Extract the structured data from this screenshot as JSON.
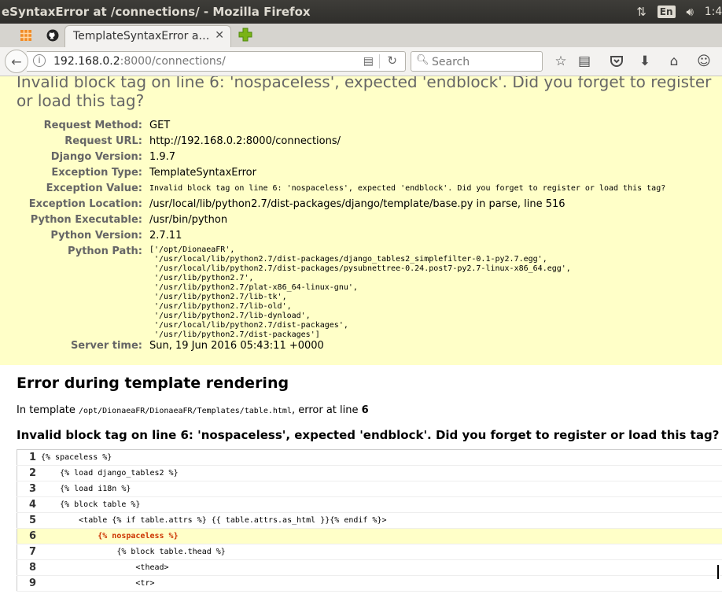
{
  "window": {
    "title": "eSyntaxError at /connections/ - Mozilla Firefox"
  },
  "tray": {
    "keyboard_layout": "En",
    "clock": "1:4"
  },
  "tabs": {
    "active_label": "TemplateSyntaxError a…"
  },
  "navbar": {
    "url_host": "192.168.0.2",
    "url_rest": ":8000/connections/",
    "search_placeholder": "Search"
  },
  "page": {
    "error_heading": "Invalid block tag on line 6: 'nospaceless', expected 'endblock'. Did you forget to register or load this tag?",
    "meta": [
      {
        "label": "Request Method:",
        "value": "GET"
      },
      {
        "label": "Request URL:",
        "value": "http://192.168.0.2:8000/connections/"
      },
      {
        "label": "Django Version:",
        "value": "1.9.7"
      },
      {
        "label": "Exception Type:",
        "value": "TemplateSyntaxError"
      },
      {
        "label": "Exception Value:",
        "value": "Invalid block tag on line 6: 'nospaceless', expected 'endblock'. Did you forget to register or load this tag?"
      },
      {
        "label": "Exception Location:",
        "value": "/usr/local/lib/python2.7/dist-packages/django/template/base.py in parse, line 516"
      },
      {
        "label": "Python Executable:",
        "value": "/usr/bin/python"
      },
      {
        "label": "Python Version:",
        "value": "2.7.11"
      },
      {
        "label": "Python Path:",
        "value": "['/opt/DionaeaFR',\n '/usr/local/lib/python2.7/dist-packages/django_tables2_simplefilter-0.1-py2.7.egg',\n '/usr/local/lib/python2.7/dist-packages/pysubnettree-0.24.post7-py2.7-linux-x86_64.egg',\n '/usr/lib/python2.7',\n '/usr/lib/python2.7/plat-x86_64-linux-gnu',\n '/usr/lib/python2.7/lib-tk',\n '/usr/lib/python2.7/lib-old',\n '/usr/lib/python2.7/lib-dynload',\n '/usr/local/lib/python2.7/dist-packages',\n '/usr/lib/python2.7/dist-packages']"
      },
      {
        "label": "Server time:",
        "value": "Sun, 19 Jun 2016 05:43:11 +0000"
      }
    ],
    "template": {
      "heading": "Error during template rendering",
      "info_prefix": "In template ",
      "path": "/opt/DionaeaFR/DionaeaFR/Templates/table.html",
      "info_mid": ", error at line ",
      "line": "6",
      "error": "Invalid block tag on line 6: 'nospaceless', expected 'endblock'. Did you forget to register or load this tag?",
      "source": [
        {
          "num": "1",
          "code": "{% spaceless %}"
        },
        {
          "num": "2",
          "code": "    {% load django_tables2 %}"
        },
        {
          "num": "3",
          "code": "    {% load i18n %}"
        },
        {
          "num": "4",
          "code": "    {% block table %}"
        },
        {
          "num": "5",
          "code": "        <table {% if table.attrs %} {{ table.attrs.as_html }}{% endif %}>"
        },
        {
          "num": "6",
          "code": "            {% nospaceless %}"
        },
        {
          "num": "7",
          "code": "                {% block table.thead %}"
        },
        {
          "num": "8",
          "code": "                    <thead>"
        },
        {
          "num": "9",
          "code": "                    <tr>"
        }
      ]
    }
  },
  "colors": {
    "summary_bg": "#ffffc8",
    "error_line": "#cc3300",
    "titlebar": "#3c3b37"
  }
}
